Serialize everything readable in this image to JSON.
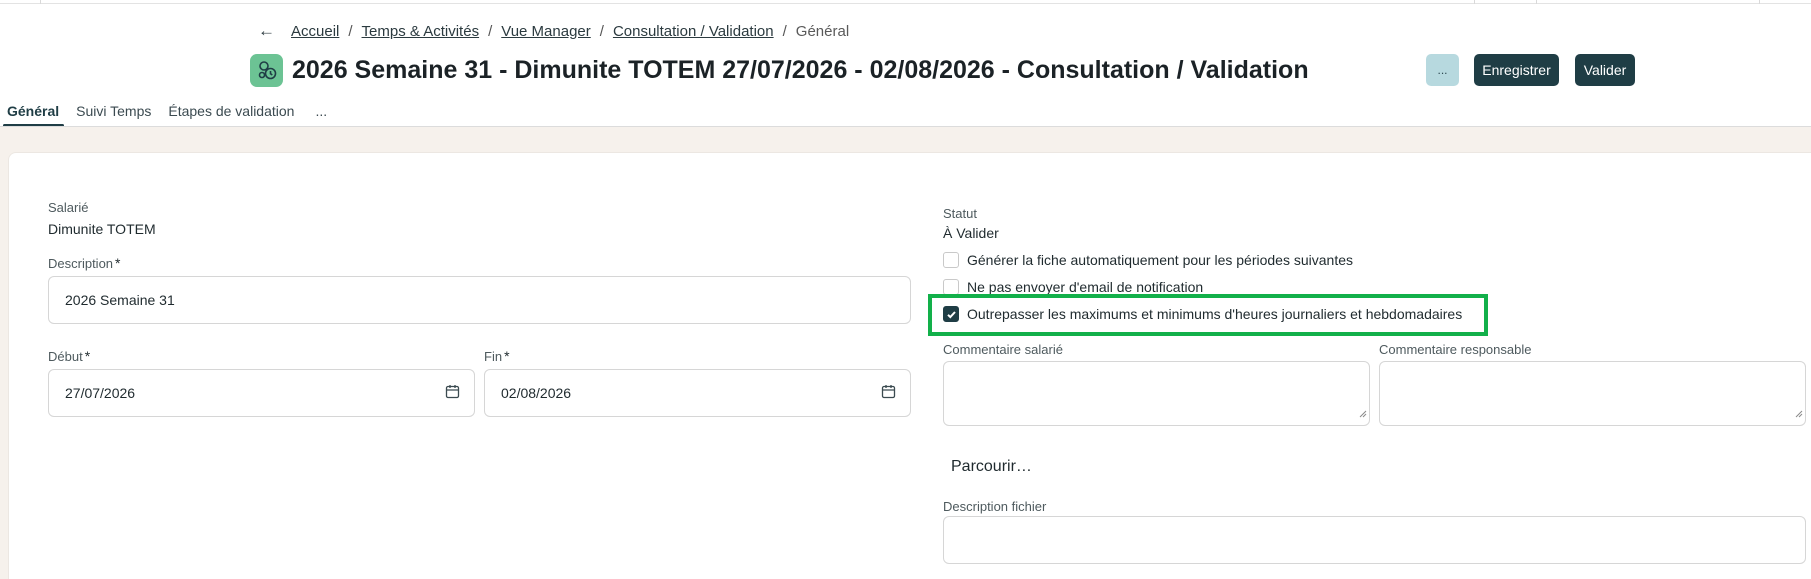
{
  "breadcrumb": {
    "back_icon": "arrow-left-icon",
    "items": [
      "Accueil",
      "Temps & Activités",
      "Vue Manager",
      "Consultation / Validation"
    ],
    "current": "Général"
  },
  "header": {
    "app_icon": "timesheet-app-icon",
    "title": "2026 Semaine 31 - Dimunite TOTEM 27/07/2026 - 02/08/2026 - Consultation / Validation"
  },
  "actions": {
    "more_label": "...",
    "save_label": "Enregistrer",
    "validate_label": "Valider"
  },
  "tabs": [
    {
      "label": "Général",
      "active": true
    },
    {
      "label": "Suivi Temps",
      "active": false
    },
    {
      "label": "Étapes de validation",
      "active": false
    },
    {
      "label": "...",
      "active": false
    }
  ],
  "form": {
    "employee_label": "Salarié",
    "employee_value": "Dimunite TOTEM",
    "description_label": "Description",
    "description_value": "2026 Semaine 31",
    "start_label": "Début",
    "start_value": "27/07/2026",
    "end_label": "Fin",
    "end_value": "02/08/2026",
    "required_mark": "*",
    "status_label": "Statut",
    "status_value": "À Valider",
    "checkboxes": [
      {
        "label": "Générer la fiche automatiquement pour les périodes suivantes",
        "checked": false
      },
      {
        "label": "Ne pas envoyer d'email de notification",
        "checked": false
      },
      {
        "label": "Outrepasser les maximums et minimums d'heures journaliers et hebdomadaires",
        "checked": true
      }
    ],
    "employee_comment_label": "Commentaire salarié",
    "manager_comment_label": "Commentaire responsable",
    "browse_label": "Parcourir…",
    "file_description_label": "Description fichier"
  },
  "colors": {
    "accent_dark": "#1f3d45",
    "highlight": "#12b04a",
    "app_icon_bg": "#6cc394",
    "page_bg": "#f6f1ec"
  }
}
